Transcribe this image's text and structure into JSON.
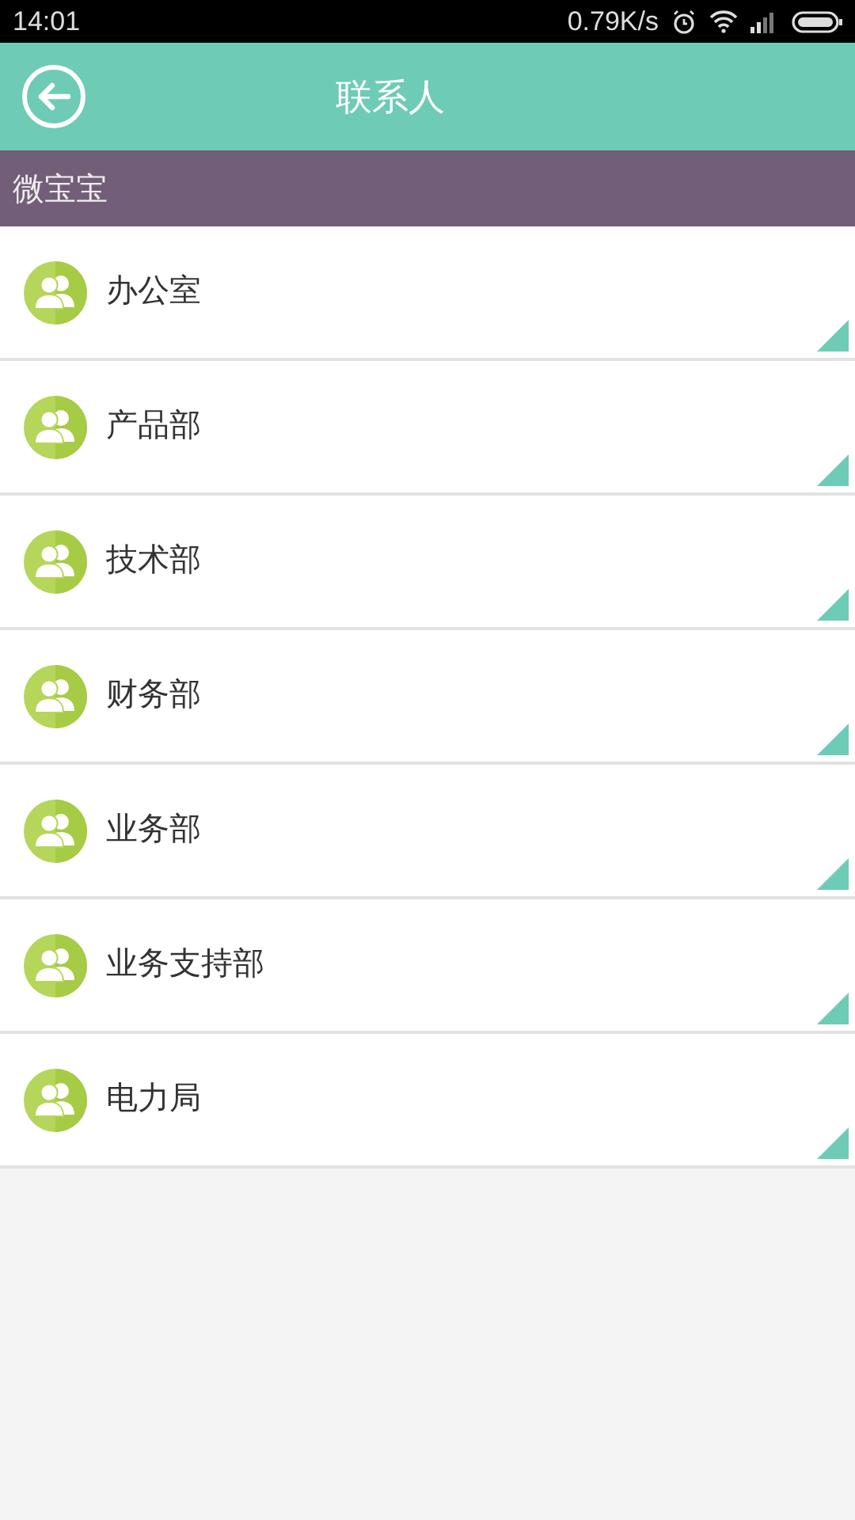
{
  "status_bar": {
    "time": "14:01",
    "speed": "0.79K/s"
  },
  "header": {
    "title": "联系人"
  },
  "section": {
    "title": "微宝宝"
  },
  "groups": [
    {
      "name": "办公室"
    },
    {
      "name": "产品部"
    },
    {
      "name": "技术部"
    },
    {
      "name": "财务部"
    },
    {
      "name": "业务部"
    },
    {
      "name": "业务支持部"
    },
    {
      "name": "电力局"
    }
  ]
}
